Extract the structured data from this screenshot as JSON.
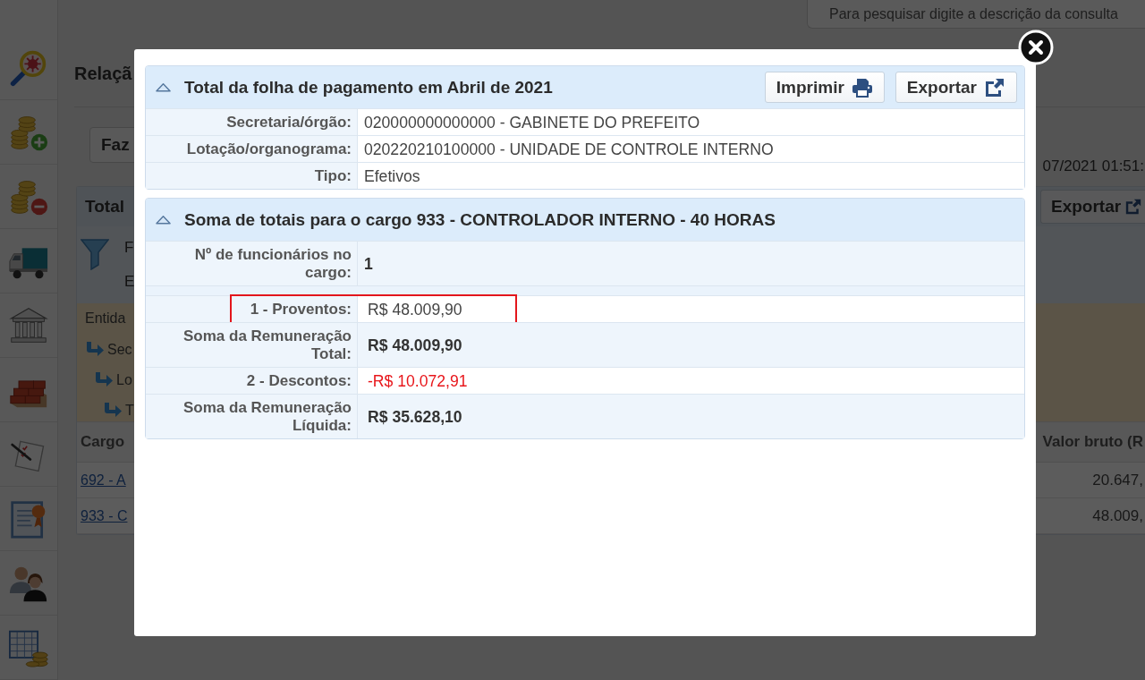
{
  "search": {
    "placeholder": "Para pesquisar digite a descrição da consulta"
  },
  "sidebar": {
    "items": [
      {
        "kind": "magnifier"
      },
      {
        "kind": "coins-add"
      },
      {
        "kind": "coins-remove"
      },
      {
        "kind": "truck"
      },
      {
        "kind": "bank"
      },
      {
        "kind": "bricks"
      },
      {
        "kind": "checklist"
      },
      {
        "kind": "certificate"
      },
      {
        "kind": "people"
      },
      {
        "kind": "spreadsheet"
      }
    ]
  },
  "page": {
    "title": "Relaçã",
    "button": "Faz",
    "timestamp": "07/2021 01:51:",
    "panel": {
      "title": "Total",
      "export_button": "Exportar",
      "filter_lines": [
        "F",
        "E"
      ],
      "entity_label": "Entida",
      "tree": [
        {
          "label": "Sec",
          "children": [
            {
              "label": "Lo",
              "children": [
                {
                  "label": "T"
                }
              ]
            }
          ]
        }
      ]
    },
    "table": {
      "columns": [
        "Cargo",
        "Valor bruto (R"
      ],
      "rows": [
        {
          "cells": [
            "692 - A",
            "20.647,"
          ]
        },
        {
          "cells": [
            "933 - C",
            "48.009,"
          ]
        }
      ]
    }
  },
  "dialog": {
    "sections": [
      {
        "title": "Total da folha de pagamento em Abril de 2021",
        "expanded": true,
        "actions": [
          {
            "label": "Imprimir",
            "kind": "print"
          },
          {
            "label": "Exportar",
            "kind": "export"
          }
        ],
        "rows": [
          {
            "label": "Secretaria/órgão:",
            "value": "020000000000000 - GABINETE DO PREFEITO",
            "kind": "info",
            "highlighted": false
          },
          {
            "label": "Lotação/organograma:",
            "value": "020220210100000 - UNIDADE DE CONTROLE INTERNO",
            "kind": "info",
            "highlighted": false
          },
          {
            "label": "Tipo:",
            "value": "Efetivos",
            "kind": "info",
            "highlighted": false
          }
        ]
      },
      {
        "title": "Soma de totais para o cargo 933 - CONTROLADOR INTERNO - 40 HORAS",
        "expanded": true,
        "rows": [
          {
            "label": "Nº de funcionários no cargo:",
            "value": "1",
            "kind": "count",
            "highlighted": false
          },
          {
            "label": "1 - Proventos:",
            "value": "R$ 48.009,90",
            "kind": "item",
            "highlighted": true
          },
          {
            "label": "Soma da Remuneração Total:",
            "value": "R$ 48.009,90",
            "kind": "summary",
            "highlighted": false
          },
          {
            "label": "2 - Descontos:",
            "value": "-R$ 10.072,91",
            "kind": "deduction",
            "highlighted": false
          },
          {
            "label": "Soma da Remuneração Líquida:",
            "value": "R$ 35.628,10",
            "kind": "summary",
            "highlighted": false
          }
        ]
      }
    ]
  }
}
